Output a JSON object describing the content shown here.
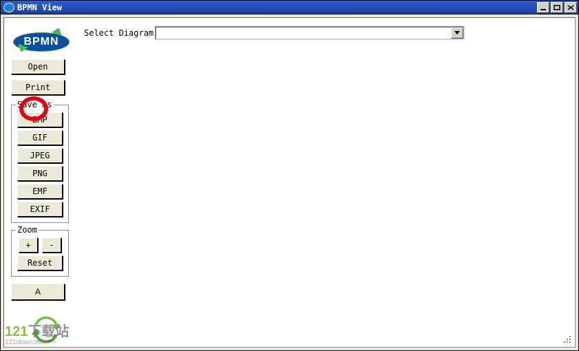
{
  "window": {
    "title": "BPMN View"
  },
  "logo": {
    "text": "BPMN"
  },
  "topbar": {
    "select_label": "Select Diagram",
    "selected_value": ""
  },
  "buttons": {
    "open": "Open",
    "print": "Print",
    "about": "A"
  },
  "save_as": {
    "title": "Save As",
    "items": [
      "BMP",
      "GIF",
      "JPEG",
      "PNG",
      "EMF",
      "EXIF"
    ]
  },
  "zoom": {
    "title": "Zoom",
    "plus": "+",
    "minus": "-",
    "reset": "Reset"
  },
  "watermark": {
    "brand_num": "121",
    "brand_text": "下载站",
    "url": "121down.com"
  }
}
